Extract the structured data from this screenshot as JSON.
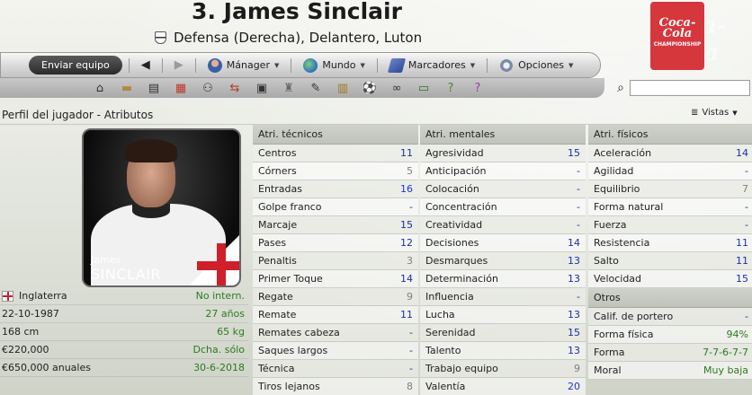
{
  "header": {
    "player_title": "3. James Sinclair",
    "subtitle": "Defensa (Derecha), Delantero, Luton"
  },
  "league_logo": {
    "text1": "Coca-Cola",
    "text2": "CHAMPIONSHIP"
  },
  "navbar": {
    "send_button": "Enviar equipo",
    "menus": [
      {
        "label": "Mánager",
        "icon": "manager-icon"
      },
      {
        "label": "Mundo",
        "icon": "globe-icon"
      },
      {
        "label": "Marcadores",
        "icon": "scores-icon"
      },
      {
        "label": "Opciones",
        "icon": "options-icon"
      }
    ]
  },
  "toolbar": {
    "icons": [
      "home-icon",
      "inbox-icon",
      "news-icon",
      "calendar-icon",
      "squad-icon",
      "transfers-icon",
      "tactics-icon",
      "trophy-icon",
      "search-player-icon",
      "clipboard-icon",
      "training-icon",
      "scouting-icon",
      "finance-icon",
      "help-icon",
      "question-icon"
    ]
  },
  "search": {
    "placeholder": ""
  },
  "breadcrumb": "Perfil del jugador - Atributos",
  "views_label": "Vistas",
  "photo": {
    "first_name": "James",
    "last_name": "SINCLAIR"
  },
  "info": [
    {
      "left": "Inglaterra",
      "right": "No intern."
    },
    {
      "left": "22-10-1987",
      "right": "27 años"
    },
    {
      "left": "168 cm",
      "right": "65 kg"
    },
    {
      "left": "€220,000",
      "right": "Dcha. sólo"
    },
    {
      "left": "€650,000 anuales",
      "right": "30-6-2018"
    }
  ],
  "tecnicos": {
    "title": "Atri. técnicos",
    "rows": [
      {
        "name": "Centros",
        "value": "11",
        "tone": "blue"
      },
      {
        "name": "Córners",
        "value": "5",
        "tone": "grey"
      },
      {
        "name": "Entradas",
        "value": "16",
        "tone": "bright"
      },
      {
        "name": "Golpe franco",
        "value": "-",
        "tone": "dash"
      },
      {
        "name": "Marcaje",
        "value": "15",
        "tone": "blue"
      },
      {
        "name": "Pases",
        "value": "12",
        "tone": "blue"
      },
      {
        "name": "Penaltis",
        "value": "3",
        "tone": "grey"
      },
      {
        "name": "Primer Toque",
        "value": "14",
        "tone": "blue"
      },
      {
        "name": "Regate",
        "value": "9",
        "tone": "grey"
      },
      {
        "name": "Remate",
        "value": "11",
        "tone": "blue"
      },
      {
        "name": "Remates cabeza",
        "value": "-",
        "tone": "dash"
      },
      {
        "name": "Saques largos",
        "value": "-",
        "tone": "dash"
      },
      {
        "name": "Técnica",
        "value": "-",
        "tone": "dash"
      },
      {
        "name": "Tiros lejanos",
        "value": "8",
        "tone": "grey"
      }
    ]
  },
  "mentales": {
    "title": "Atri. mentales",
    "rows": [
      {
        "name": "Agresividad",
        "value": "15",
        "tone": "blue"
      },
      {
        "name": "Anticipación",
        "value": "-",
        "tone": "dash"
      },
      {
        "name": "Colocación",
        "value": "-",
        "tone": "dash"
      },
      {
        "name": "Concentración",
        "value": "-",
        "tone": "dash"
      },
      {
        "name": "Creatividad",
        "value": "-",
        "tone": "dash"
      },
      {
        "name": "Decisiones",
        "value": "14",
        "tone": "blue"
      },
      {
        "name": "Desmarques",
        "value": "13",
        "tone": "blue"
      },
      {
        "name": "Determinación",
        "value": "13",
        "tone": "blue"
      },
      {
        "name": "Influencia",
        "value": "-",
        "tone": "dash"
      },
      {
        "name": "Lucha",
        "value": "13",
        "tone": "blue"
      },
      {
        "name": "Serenidad",
        "value": "15",
        "tone": "blue"
      },
      {
        "name": "Talento",
        "value": "13",
        "tone": "blue"
      },
      {
        "name": "Trabajo equipo",
        "value": "9",
        "tone": "grey"
      },
      {
        "name": "Valentía",
        "value": "20",
        "tone": "bright"
      }
    ]
  },
  "fisicos": {
    "title": "Atri. físicos",
    "rows": [
      {
        "name": "Aceleración",
        "value": "14",
        "tone": "blue"
      },
      {
        "name": "Agilidad",
        "value": "-",
        "tone": "dash"
      },
      {
        "name": "Equilibrio",
        "value": "7",
        "tone": "grey"
      },
      {
        "name": "Forma natural",
        "value": "-",
        "tone": "dash"
      },
      {
        "name": "Fuerza",
        "value": "-",
        "tone": "dash"
      },
      {
        "name": "Resistencia",
        "value": "11",
        "tone": "blue"
      },
      {
        "name": "Salto",
        "value": "11",
        "tone": "blue"
      },
      {
        "name": "Velocidad",
        "value": "15",
        "tone": "blue"
      }
    ]
  },
  "otros": {
    "title": "Otros",
    "rows": [
      {
        "name": "Calif. de portero",
        "value": "-",
        "tone": "dash"
      },
      {
        "name": "Forma física",
        "value": "94%",
        "tone": "green"
      },
      {
        "name": "Forma",
        "value": "7-7-6-7-7",
        "tone": "greenn"
      },
      {
        "name": "Moral",
        "value": "Muy baja",
        "tone": "greenn"
      }
    ]
  }
}
